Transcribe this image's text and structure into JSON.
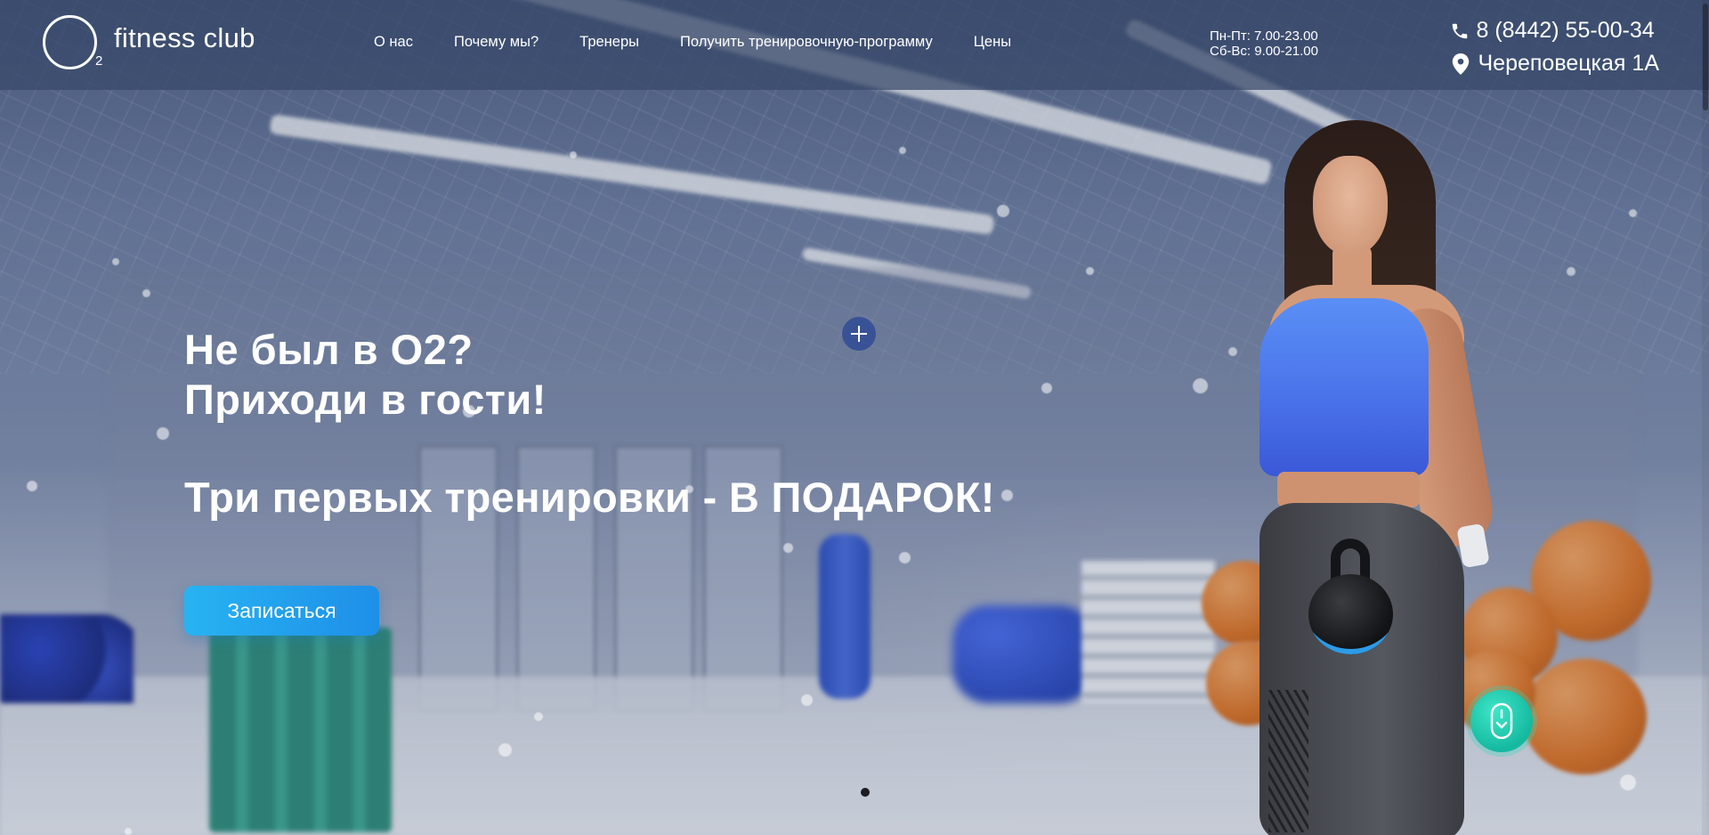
{
  "logo": {
    "sub": "2",
    "text": "fitness club"
  },
  "nav": {
    "items": [
      {
        "label": "О нас"
      },
      {
        "label": "Почему мы?"
      },
      {
        "label": "Тренеры"
      },
      {
        "label": "Получить тренировочную-программу"
      },
      {
        "label": "Цены"
      }
    ]
  },
  "hours": {
    "weekdays": "Пн-Пт: 7.00-23.00",
    "weekend": "Сб-Вс: 9.00-21.00"
  },
  "contacts": {
    "phone": "8 (8442) 55-00-34",
    "address": "Череповецкая 1А",
    "phone_icon": "phone-icon",
    "address_icon": "location-pin-icon"
  },
  "hero": {
    "line1": "Не был в О2?",
    "line2": "Приходи в гости!",
    "offer": "Три первых тренировки - В ПОДАРОК!",
    "cta_label": "Записаться"
  },
  "slider": {
    "active_index": 0,
    "count": 1
  },
  "colors": {
    "cta_gradient_start": "#27b3f2",
    "cta_gradient_end": "#1e8fe8",
    "header_bg": "#374869",
    "scroll_button": "#14b9a0"
  }
}
